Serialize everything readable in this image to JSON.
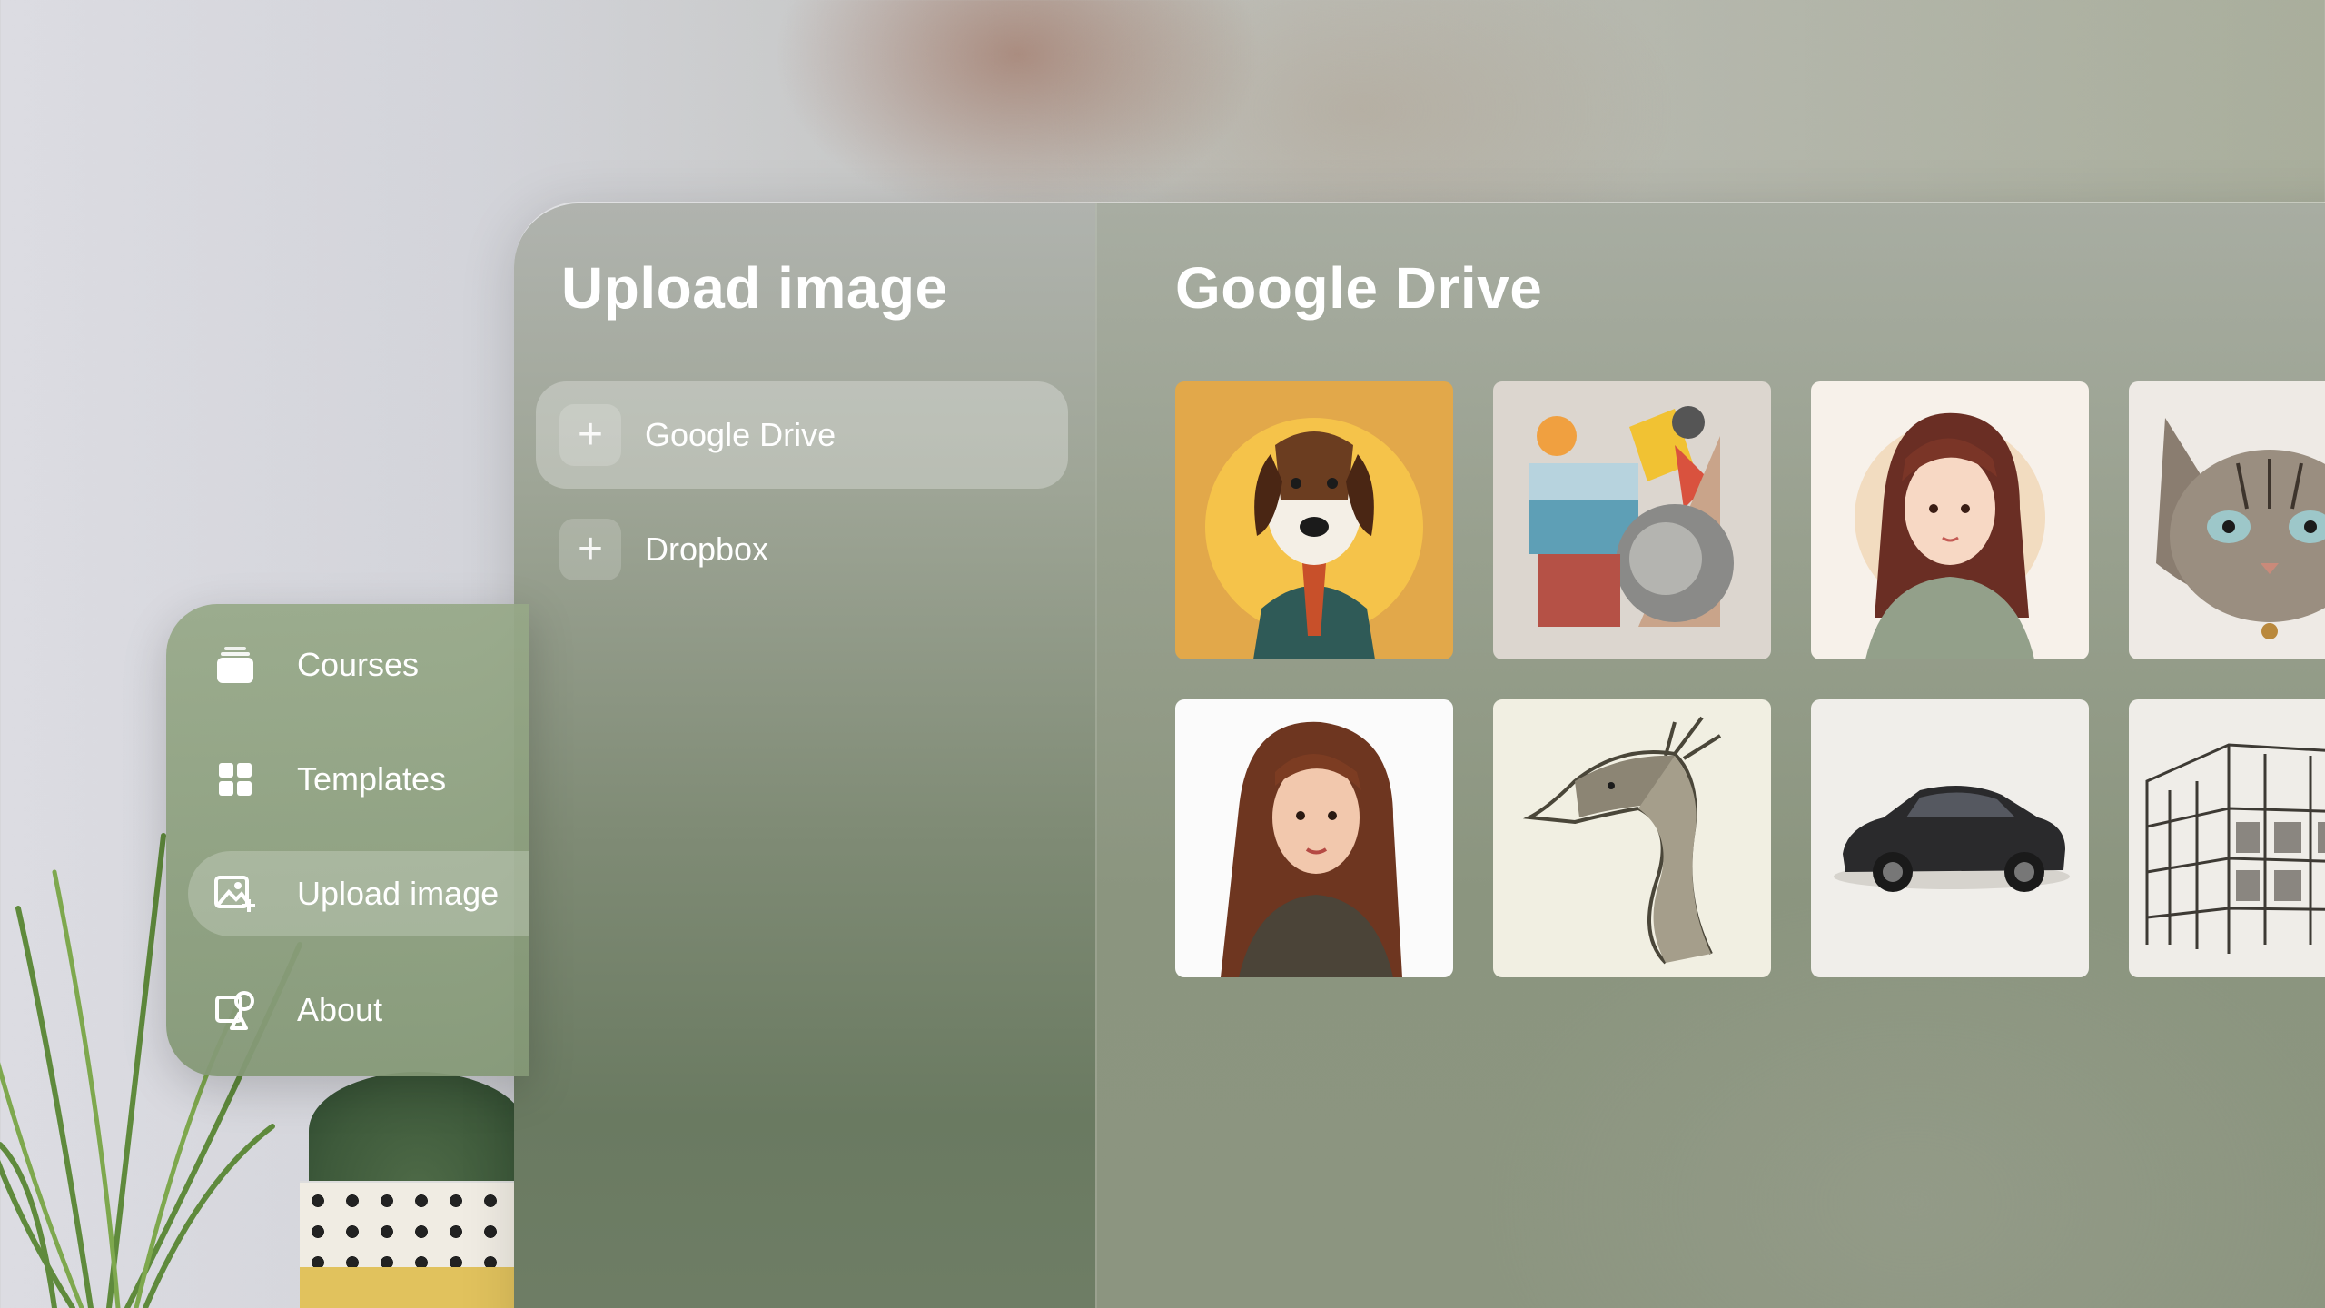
{
  "left_panel": {
    "title": "Upload image",
    "sources": [
      {
        "label": "Google Drive",
        "selected": true
      },
      {
        "label": "Dropbox",
        "selected": false
      }
    ]
  },
  "right_panel": {
    "title": "Google Drive",
    "images": [
      {
        "name": "dog-portrait",
        "background": "#e2a84a"
      },
      {
        "name": "collage",
        "background": "#dcd6cf"
      },
      {
        "name": "girl-illustration",
        "background": "#f7f1ea"
      },
      {
        "name": "cat-sketch",
        "background": "#eeeae5"
      },
      {
        "name": "woman-portrait",
        "background": "#fbfbfb"
      },
      {
        "name": "dragon-sketch",
        "background": "#f1efe2"
      },
      {
        "name": "car-sketch",
        "background": "#f0eeea"
      },
      {
        "name": "building-sketch",
        "background": "#efede8"
      }
    ]
  },
  "nav": {
    "items": [
      {
        "label": "Courses",
        "icon": "stack-icon",
        "active": false
      },
      {
        "label": "Templates",
        "icon": "grid-icon",
        "active": false
      },
      {
        "label": "Upload image",
        "icon": "image-add-icon",
        "active": true
      },
      {
        "label": "About",
        "icon": "shapes-icon",
        "active": false
      }
    ]
  }
}
